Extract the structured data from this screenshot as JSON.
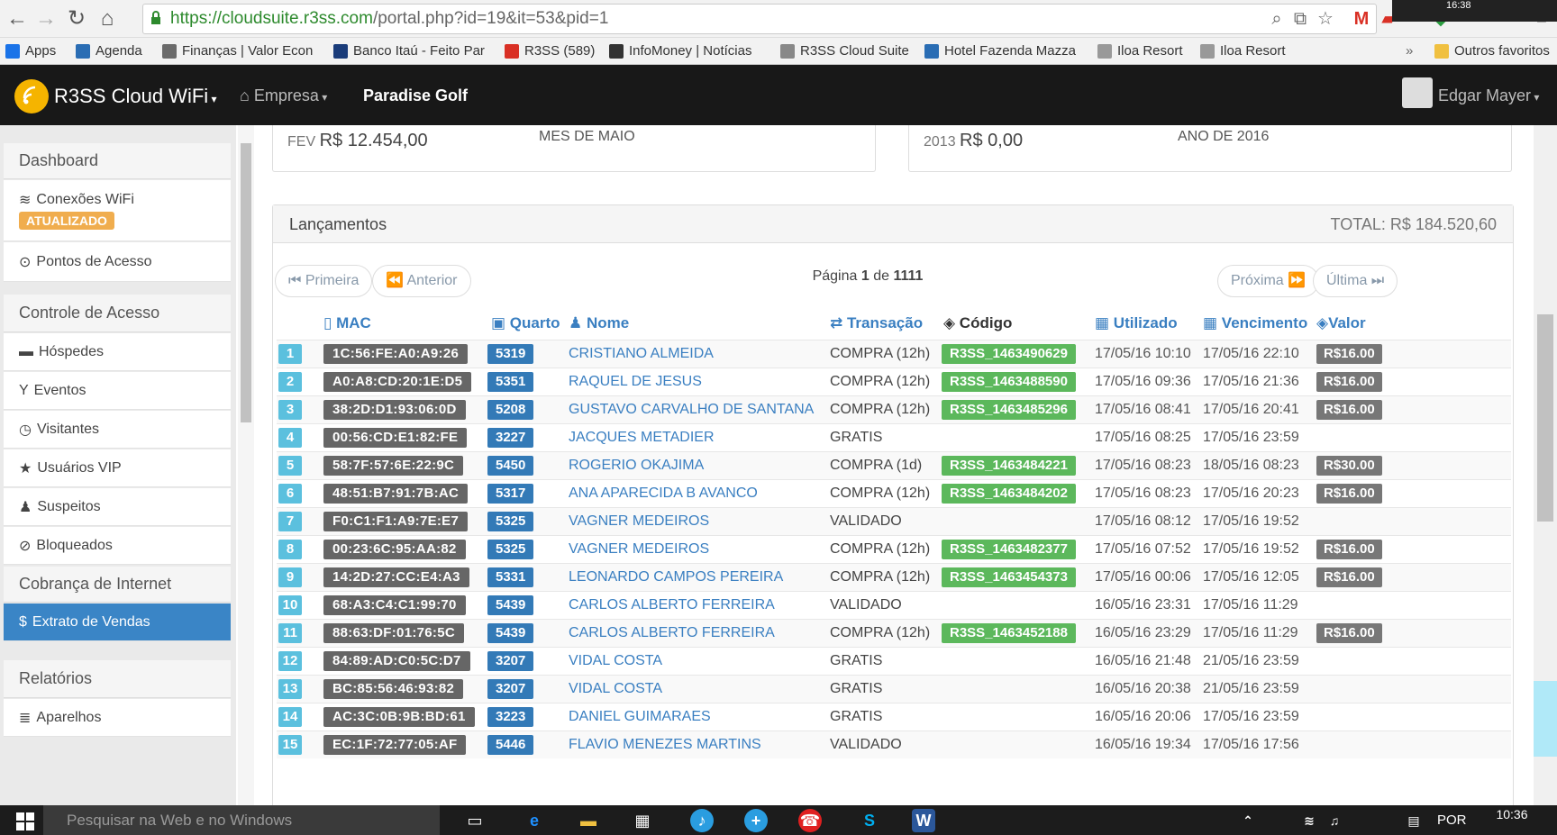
{
  "browser": {
    "url_secure": "https://cloudsuite.r3ss.com",
    "url_rest": "/portal.php?id=19&it=53&pid=1",
    "tab_time": "16:38"
  },
  "bookmarks": [
    {
      "label": "Apps",
      "color": "#1a73e8"
    },
    {
      "label": "Agenda",
      "color": "#2a6db4"
    },
    {
      "label": "Finanças | Valor Econ",
      "color": "#6b6b6b"
    },
    {
      "label": "Banco Itaú - Feito Par",
      "color": "#1a3c7a"
    },
    {
      "label": "R3SS (589)",
      "color": "#d93025"
    },
    {
      "label": "InfoMoney | Notícias",
      "color": "#333333"
    },
    {
      "label": "R3SS Cloud Suite",
      "color": "#888888"
    },
    {
      "label": "Hotel Fazenda Mazza",
      "color": "#2a6db4"
    },
    {
      "label": "Iloa Resort",
      "color": "#999999"
    },
    {
      "label": "Iloa Resort",
      "color": "#999999"
    },
    {
      "label": "Outros favoritos",
      "color": "#f0c040"
    }
  ],
  "topbar": {
    "brand": "R3SS Cloud WiFi",
    "empresa": "Empresa",
    "location": "Paradise Golf",
    "user": "Edgar Mayer"
  },
  "sidebar": {
    "dashboard": "Dashboard",
    "conexoes": "Conexões WiFi",
    "conexoes_badge": "ATUALIZADO",
    "pontos": "Pontos de Acesso",
    "controle": "Controle de Acesso",
    "hospedes": "Hóspedes",
    "eventos": "Eventos",
    "visitantes": "Visitantes",
    "vip": "Usuários VIP",
    "suspeitos": "Suspeitos",
    "bloqueados": "Bloqueados",
    "cobranca": "Cobrança de Internet",
    "extrato": "Extrato de Vendas",
    "relatorios": "Relatórios",
    "aparelhos": "Aparelhos"
  },
  "cards": {
    "c1_prefix": "FEV",
    "c1_value": "R$ 12.454,00",
    "c1_label": "MES DE MAIO",
    "c2_prefix": "2013",
    "c2_value": "R$ 0,00",
    "c2_label": "ANO DE 2016"
  },
  "panel": {
    "title": "Lançamentos",
    "total": "TOTAL: R$ 184.520,60",
    "first": "Primeira",
    "prev": "Anterior",
    "page_label": "Página",
    "page_current": "1",
    "page_of": "de",
    "page_total": "1111",
    "next": "Próxima",
    "last": "Última"
  },
  "columns": {
    "mac": "MAC",
    "quarto": "Quarto",
    "nome": "Nome",
    "transacao": "Transação",
    "codigo": "Código",
    "utilizado": "Utilizado",
    "vencimento": "Vencimento",
    "valor": "Valor"
  },
  "rows": [
    {
      "n": "1",
      "mac": "1C:56:FE:A0:A9:26",
      "room": "5319",
      "name": "CRISTIANO ALMEIDA",
      "tx": "COMPRA (12h)",
      "code": "R3SS_1463490629",
      "used": "17/05/16 10:10",
      "due": "17/05/16 22:10",
      "val": "R$16.00"
    },
    {
      "n": "2",
      "mac": "A0:A8:CD:20:1E:D5",
      "room": "5351",
      "name": "RAQUEL DE JESUS",
      "tx": "COMPRA (12h)",
      "code": "R3SS_1463488590",
      "used": "17/05/16 09:36",
      "due": "17/05/16 21:36",
      "val": "R$16.00"
    },
    {
      "n": "3",
      "mac": "38:2D:D1:93:06:0D",
      "room": "5208",
      "name": "GUSTAVO CARVALHO DE SANTANA",
      "tx": "COMPRA (12h)",
      "code": "R3SS_1463485296",
      "used": "17/05/16 08:41",
      "due": "17/05/16 20:41",
      "val": "R$16.00"
    },
    {
      "n": "4",
      "mac": "00:56:CD:E1:82:FE",
      "room": "3227",
      "name": "JACQUES METADIER",
      "tx": "GRATIS",
      "code": "",
      "used": "17/05/16 08:25",
      "due": "17/05/16 23:59",
      "val": ""
    },
    {
      "n": "5",
      "mac": "58:7F:57:6E:22:9C",
      "room": "5450",
      "name": "ROGERIO OKAJIMA",
      "tx": "COMPRA (1d)",
      "code": "R3SS_1463484221",
      "used": "17/05/16 08:23",
      "due": "18/05/16 08:23",
      "val": "R$30.00"
    },
    {
      "n": "6",
      "mac": "48:51:B7:91:7B:AC",
      "room": "5317",
      "name": "ANA APARECIDA B AVANCO",
      "tx": "COMPRA (12h)",
      "code": "R3SS_1463484202",
      "used": "17/05/16 08:23",
      "due": "17/05/16 20:23",
      "val": "R$16.00"
    },
    {
      "n": "7",
      "mac": "F0:C1:F1:A9:7E:E7",
      "room": "5325",
      "name": "VAGNER MEDEIROS",
      "tx": "VALIDADO",
      "code": "",
      "used": "17/05/16 08:12",
      "due": "17/05/16 19:52",
      "val": ""
    },
    {
      "n": "8",
      "mac": "00:23:6C:95:AA:82",
      "room": "5325",
      "name": "VAGNER MEDEIROS",
      "tx": "COMPRA (12h)",
      "code": "R3SS_1463482377",
      "used": "17/05/16 07:52",
      "due": "17/05/16 19:52",
      "val": "R$16.00"
    },
    {
      "n": "9",
      "mac": "14:2D:27:CC:E4:A3",
      "room": "5331",
      "name": "LEONARDO CAMPOS PEREIRA",
      "tx": "COMPRA (12h)",
      "code": "R3SS_1463454373",
      "used": "17/05/16 00:06",
      "due": "17/05/16 12:05",
      "val": "R$16.00"
    },
    {
      "n": "10",
      "mac": "68:A3:C4:C1:99:70",
      "room": "5439",
      "name": "CARLOS ALBERTO FERREIRA",
      "tx": "VALIDADO",
      "code": "",
      "used": "16/05/16 23:31",
      "due": "17/05/16 11:29",
      "val": ""
    },
    {
      "n": "11",
      "mac": "88:63:DF:01:76:5C",
      "room": "5439",
      "name": "CARLOS ALBERTO FERREIRA",
      "tx": "COMPRA (12h)",
      "code": "R3SS_1463452188",
      "used": "16/05/16 23:29",
      "due": "17/05/16 11:29",
      "val": "R$16.00"
    },
    {
      "n": "12",
      "mac": "84:89:AD:C0:5C:D7",
      "room": "3207",
      "name": "VIDAL COSTA",
      "tx": "GRATIS",
      "code": "",
      "used": "16/05/16 21:48",
      "due": "21/05/16 23:59",
      "val": ""
    },
    {
      "n": "13",
      "mac": "BC:85:56:46:93:82",
      "room": "3207",
      "name": "VIDAL COSTA",
      "tx": "GRATIS",
      "code": "",
      "used": "16/05/16 20:38",
      "due": "21/05/16 23:59",
      "val": ""
    },
    {
      "n": "14",
      "mac": "AC:3C:0B:9B:BD:61",
      "room": "3223",
      "name": "DANIEL GUIMARAES",
      "tx": "GRATIS",
      "code": "",
      "used": "16/05/16 20:06",
      "due": "17/05/16 23:59",
      "val": ""
    },
    {
      "n": "15",
      "mac": "EC:1F:72:77:05:AF",
      "room": "5446",
      "name": "FLAVIO MENEZES MARTINS",
      "tx": "VALIDADO",
      "code": "",
      "used": "16/05/16 19:34",
      "due": "17/05/16 17:56",
      "val": ""
    }
  ],
  "taskbar": {
    "search_placeholder": "Pesquisar na Web e no Windows",
    "lang": "POR",
    "time": "10:36"
  },
  "colors": {
    "accent": "#3a85c6",
    "badge_warning": "#f0ad4e",
    "code_green": "#5cb85c",
    "num_cyan": "#5bc0de",
    "room_blue": "#337ab7"
  }
}
